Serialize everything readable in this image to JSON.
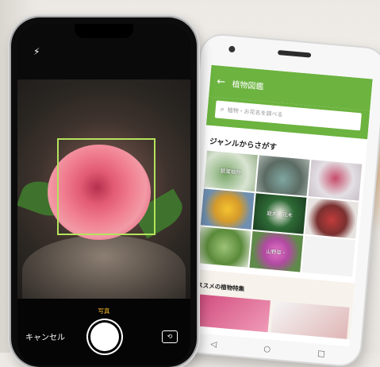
{
  "android_app": {
    "title": "植物図鑑",
    "search_placeholder": "植物・お花名を調べる",
    "genre_heading": "ジャンルからさがす",
    "genres": [
      "観葉植物",
      "",
      "",
      "",
      "庭木・花木",
      "",
      "",
      "山野草・",
      ""
    ],
    "recommend_heading": "ススメの植物特集"
  },
  "camera": {
    "mode_label": "写真",
    "cancel_label": "キャンセル"
  },
  "colors": {
    "app_green": "#6cb33f",
    "focus_frame": "#b4e35c",
    "mode_text": "#f5b829"
  },
  "icons": {
    "flash": "flash-icon",
    "back": "back-arrow-icon",
    "search": "search-icon",
    "flip": "flip-camera-icon"
  }
}
